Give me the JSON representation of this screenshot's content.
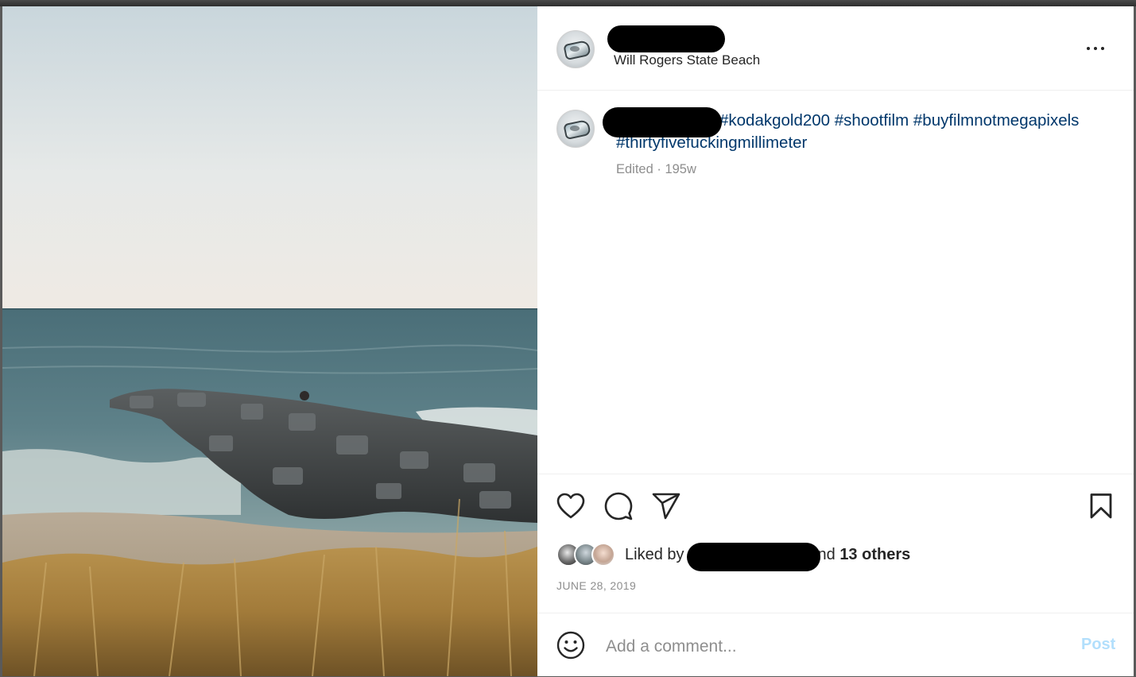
{
  "post": {
    "location": "Will Rogers State Beach",
    "caption_visible_prefix": "",
    "hashtags_line1": "#kodakgold200 #shootfilm #buyfilmnotmegapixels",
    "hashtags_line2": "#thirtyfivefuckingmillimeter",
    "meta": "Edited · 195w",
    "date": "JUNE 28, 2019"
  },
  "likes": {
    "prefix": "Liked by",
    "suffix_fragment": "nd",
    "others": "13 others"
  },
  "comment": {
    "placeholder": "Add a comment...",
    "post_label": "Post"
  },
  "icons": {
    "more": "more-options-icon",
    "like": "heart-icon",
    "comment": "comment-bubble-icon",
    "share": "paper-plane-icon",
    "save": "bookmark-icon",
    "emoji": "smiley-icon"
  },
  "colors": {
    "hashtag": "#00376b",
    "muted": "#8e8e8e",
    "post_button_disabled": "#b2dffc",
    "text": "#262626"
  }
}
